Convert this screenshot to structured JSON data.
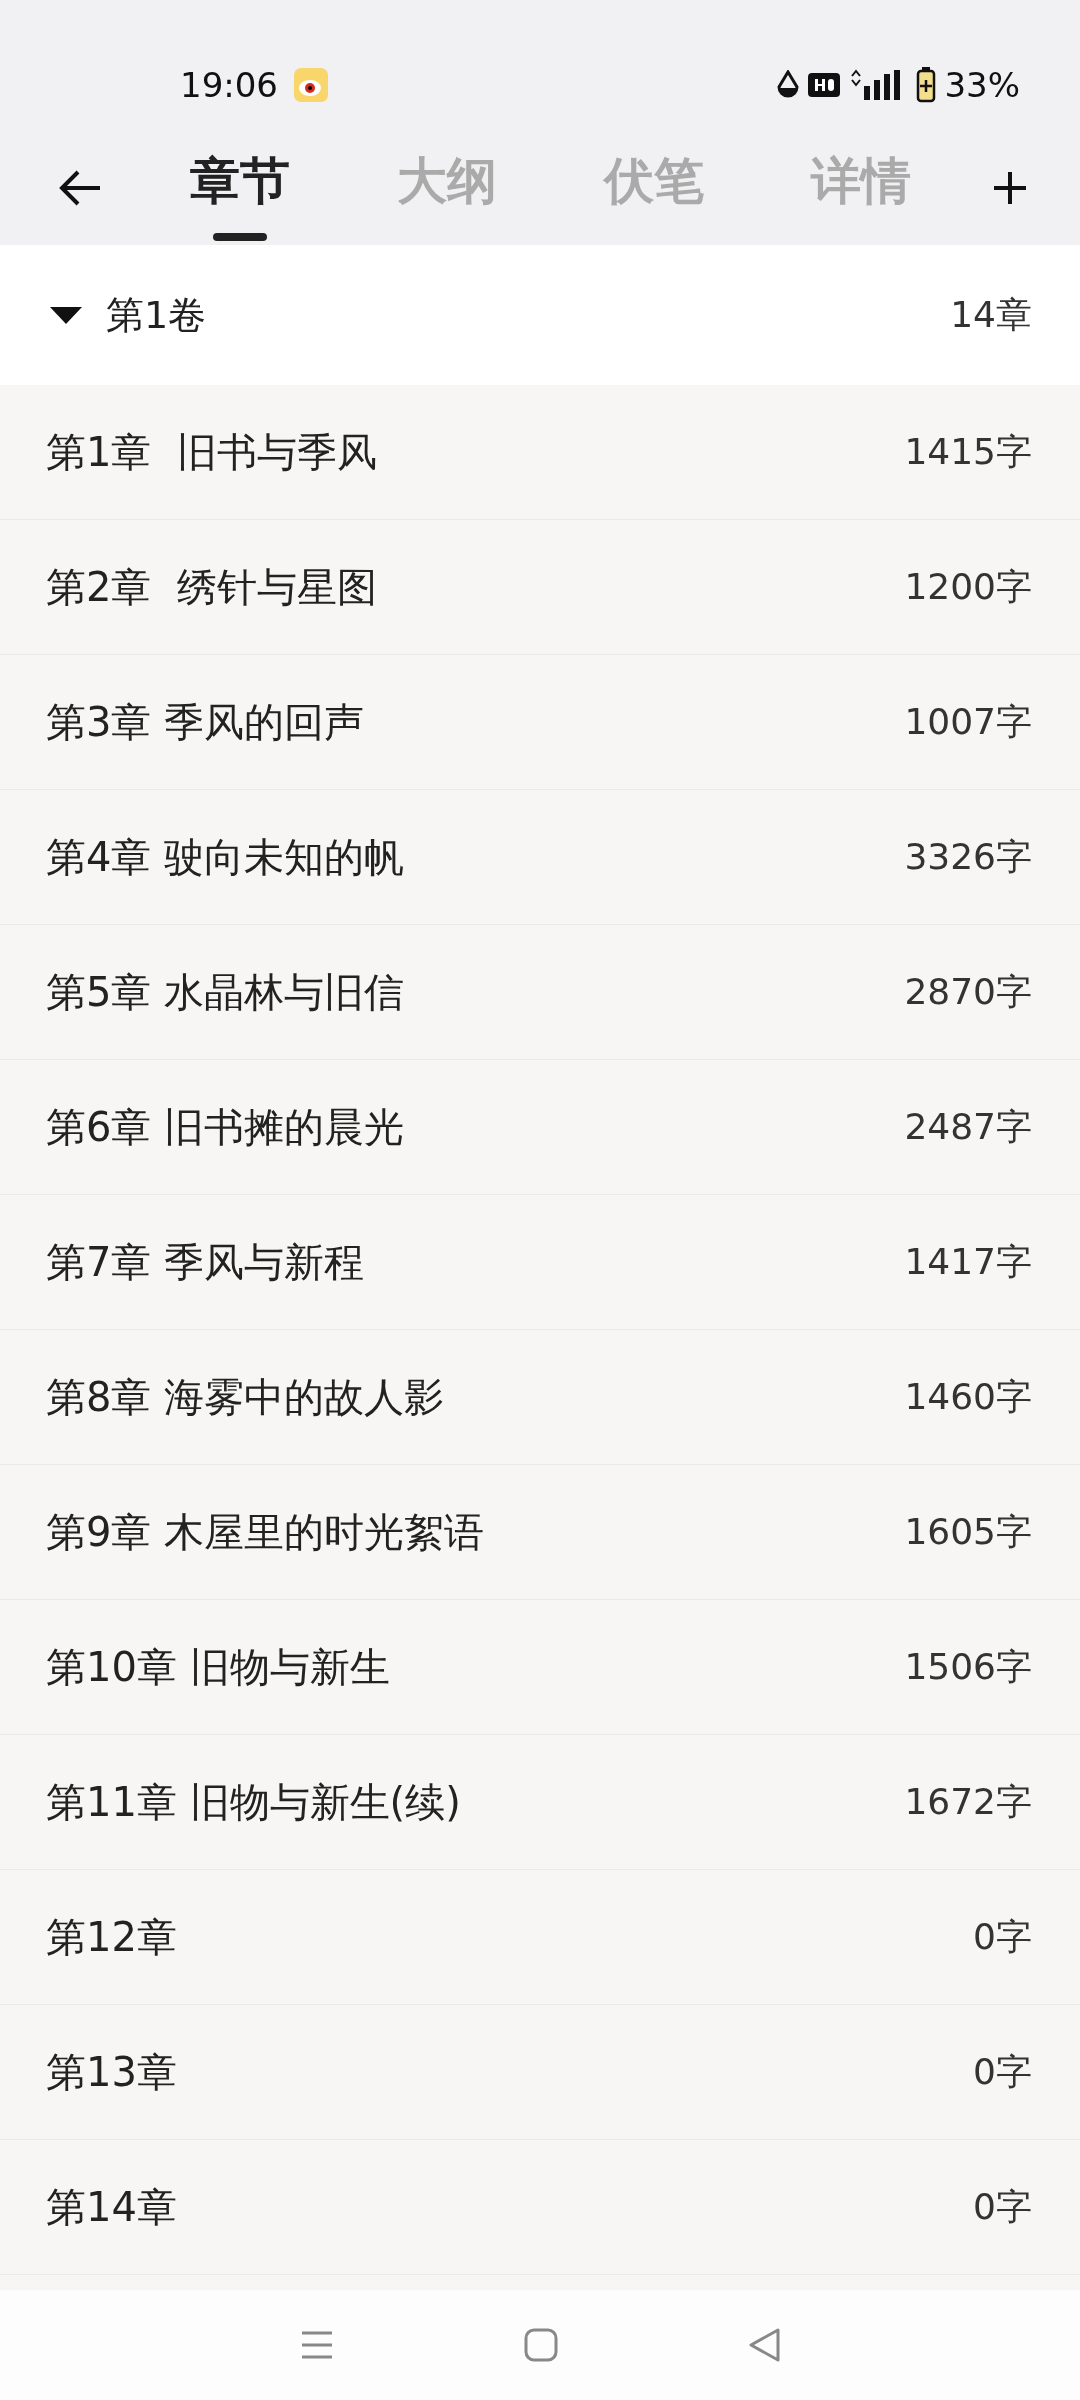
{
  "status_bar": {
    "time": "19:06",
    "battery": "33%"
  },
  "tabs": [
    {
      "label": "章节",
      "selected": true
    },
    {
      "label": "大纲",
      "selected": false
    },
    {
      "label": "伏笔",
      "selected": false
    },
    {
      "label": "详情",
      "selected": false
    }
  ],
  "volume": {
    "title": "第1卷",
    "count": "14章",
    "expanded": true
  },
  "chapters": [
    {
      "title": "第1章  旧书与季风",
      "words": "1415字"
    },
    {
      "title": "第2章  绣针与星图",
      "words": "1200字"
    },
    {
      "title": "第3章 季风的回声",
      "words": "1007字"
    },
    {
      "title": "第4章 驶向未知的帆",
      "words": "3326字"
    },
    {
      "title": "第5章 水晶林与旧信",
      "words": "2870字"
    },
    {
      "title": "第6章 旧书摊的晨光",
      "words": "2487字"
    },
    {
      "title": "第7章 季风与新程",
      "words": "1417字"
    },
    {
      "title": "第8章 海雾中的故人影",
      "words": "1460字"
    },
    {
      "title": "第9章 木屋里的时光絮语",
      "words": "1605字"
    },
    {
      "title": "第10章 旧物与新生",
      "words": "1506字"
    },
    {
      "title": "第11章 旧物与新生(续)",
      "words": "1672字"
    },
    {
      "title": "第12章",
      "words": "0字"
    },
    {
      "title": "第13章",
      "words": "0字"
    },
    {
      "title": "第14章",
      "words": "0字"
    }
  ]
}
